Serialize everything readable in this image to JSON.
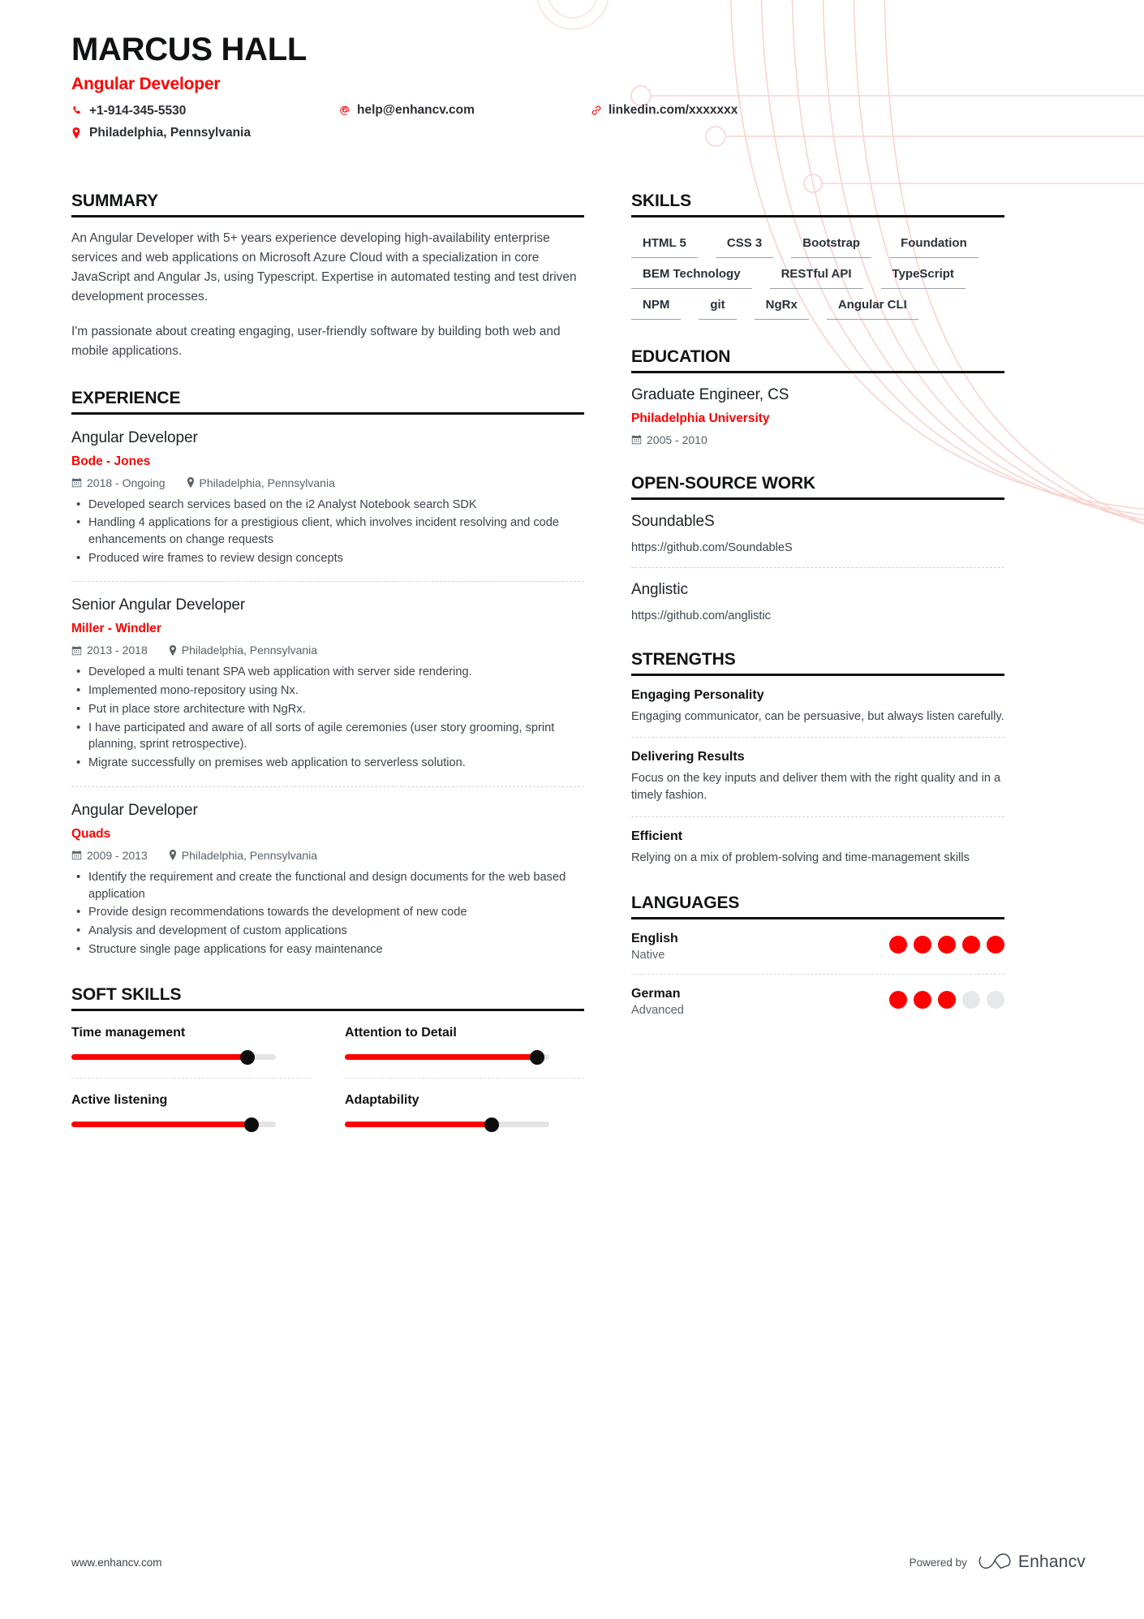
{
  "header": {
    "name": "MARCUS HALL",
    "role": "Angular Developer",
    "phone": "+1-914-345-5530",
    "email": "help@enhancv.com",
    "linkedin": "linkedin.com/xxxxxxx",
    "location": "Philadelphia, Pennsylvania",
    "icons": {
      "phone": "phone-icon",
      "email": "at-icon",
      "link": "link-icon",
      "location": "map-pin-icon"
    }
  },
  "sections": {
    "summary": "SUMMARY",
    "experience": "EXPERIENCE",
    "soft_skills": "SOFT SKILLS",
    "skills": "SKILLS",
    "education": "EDUCATION",
    "open_source": "OPEN-SOURCE WORK",
    "strengths": "STRENGTHS",
    "languages": "LANGUAGES"
  },
  "summary": {
    "paragraph1": "An Angular Developer with 5+ years experience developing high-availability enterprise services and web applications on Microsoft Azure Cloud with a specialization in core JavaScript and Angular Js, using Typescript. Expertise in automated testing and test driven development processes.",
    "paragraph2": "I'm passionate about creating engaging, user-friendly software by building both web and mobile applications."
  },
  "experience": [
    {
      "title": "Angular Developer",
      "company": "Bode - Jones",
      "dates": "2018 - Ongoing",
      "location": "Philadelphia, Pennsylvania",
      "bullets": [
        "Developed search services based on the i2 Analyst Notebook search SDK",
        "Handling 4 applications for a prestigious client, which involves incident resolving and code enhancements on change requests",
        "Produced wire frames to review design concepts"
      ]
    },
    {
      "title": "Senior Angular Developer",
      "company": "Miller - Windler",
      "dates": "2013 - 2018",
      "location": "Philadelphia, Pennsylvania",
      "bullets": [
        "Developed a multi tenant SPA web application with server side rendering.",
        "Implemented mono-repository using Nx.",
        "Put in place store architecture with NgRx.",
        "I have participated and aware of all sorts of agile ceremonies (user story grooming, sprint planning, sprint retrospective).",
        "Migrate successfully on premises web application to serverless solution."
      ]
    },
    {
      "title": "Angular Developer",
      "company": "Quads",
      "dates": "2009 - 2013",
      "location": "Philadelphia, Pennsylvania",
      "bullets": [
        "Identify the requirement and create the functional and design documents for the web based application",
        "Provide design recommendations towards the development of new code",
        "Analysis and development of custom applications",
        "Structure single page applications for easy maintenance"
      ]
    }
  ],
  "soft_skills": [
    {
      "name": "Time management",
      "percent": 86
    },
    {
      "name": "Attention to Detail",
      "percent": 94
    },
    {
      "name": "Active listening",
      "percent": 88
    },
    {
      "name": "Adaptability",
      "percent": 72
    }
  ],
  "skills": [
    "HTML 5",
    "CSS 3",
    "Bootstrap",
    "Foundation",
    "BEM Technology",
    "RESTful API",
    "TypeScript",
    "NPM",
    "git",
    "NgRx",
    "Angular CLI"
  ],
  "education": [
    {
      "degree": "Graduate Engineer, CS",
      "school": "Philadelphia University",
      "dates": "2005 - 2010"
    }
  ],
  "open_source": [
    {
      "title": "SoundableS",
      "url": "https://github.com/SoundableS"
    },
    {
      "title": "Anglistic",
      "url": "https://github.com/anglistic"
    }
  ],
  "strengths": [
    {
      "title": "Engaging Personality",
      "description": "Engaging communicator, can be persuasive, but always listen carefully."
    },
    {
      "title": "Delivering Results",
      "description": "Focus on the key inputs and deliver them with the right quality and in a timely fashion."
    },
    {
      "title": "Efficient",
      "description": "Relying on a mix of problem-solving and time-management skills"
    }
  ],
  "languages": [
    {
      "name": "English",
      "level": "Native",
      "dots": 5,
      "total": 5
    },
    {
      "name": "German",
      "level": "Advanced",
      "dots": 3,
      "total": 5
    }
  ],
  "footer": {
    "site": "www.enhancv.com",
    "powered_by": "Powered by",
    "brand": "Enhancv"
  },
  "colors": {
    "accent": "#ff0000",
    "heading": "#101214",
    "body": "#3d434a",
    "muted": "#5a6168",
    "dot_off": "#e6e8e9",
    "decor": "#fadcd9"
  }
}
